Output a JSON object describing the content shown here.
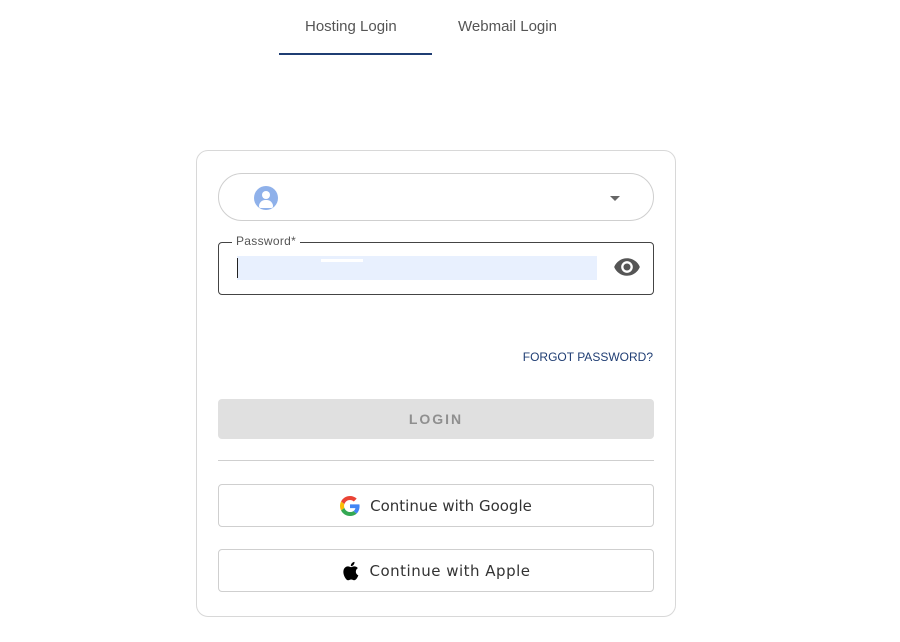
{
  "tabs": {
    "hosting_label": "Hosting Login",
    "webmail_label": "Webmail Login",
    "active": "Hosting Login"
  },
  "login_form": {
    "account_selector_value": "",
    "password_label": "Password*",
    "password_value": "",
    "forgot_label": "FORGOT PASSWORD?",
    "login_label": "LOGIN",
    "google_label": "Continue with Google",
    "apple_label": "Continue with Apple"
  },
  "icons": {
    "account": "user-avatar-icon",
    "dropdown": "caret-down-icon",
    "password_visibility": "eye-icon",
    "google": "google-logo-icon",
    "apple": "apple-logo-icon"
  },
  "colors": {
    "accent": "#1f3d73",
    "avatar": "#8fb1ea",
    "autofill": "#e8f0fe",
    "login_disabled_bg": "#e0e0e0",
    "login_disabled_text": "#8f8f8f"
  }
}
